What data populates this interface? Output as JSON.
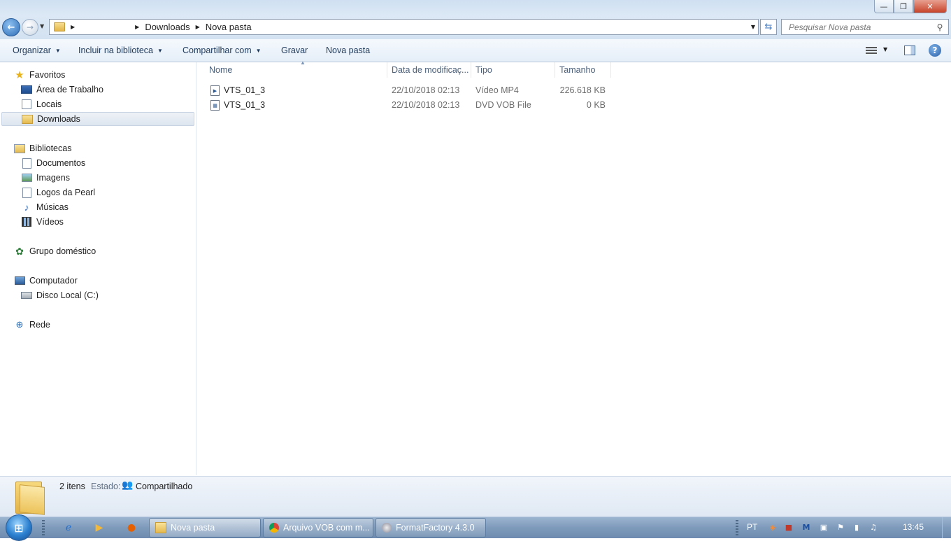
{
  "window": {
    "minimize_glyph": "—",
    "restore_glyph": "❐",
    "close_glyph": "✕"
  },
  "address": {
    "segments": [
      "Downloads",
      "Nova pasta"
    ]
  },
  "search": {
    "placeholder": "Pesquisar Nova pasta"
  },
  "toolbar": {
    "organize": "Organizar",
    "include_library": "Incluir na biblioteca",
    "share_with": "Compartilhar com",
    "burn": "Gravar",
    "new_folder": "Nova pasta"
  },
  "nav": {
    "favorites": "Favoritos",
    "desktop": "Área de Trabalho",
    "places": "Locais",
    "downloads": "Downloads",
    "libraries": "Bibliotecas",
    "documents": "Documentos",
    "images": "Imagens",
    "pearl_logos": "Logos da Pearl",
    "music": "Músicas",
    "videos": "Vídeos",
    "homegroup": "Grupo doméstico",
    "computer": "Computador",
    "local_disk": "Disco Local (C:)",
    "network": "Rede"
  },
  "columns": {
    "name": "Nome",
    "date": "Data de modificaç...",
    "type": "Tipo",
    "size": "Tamanho"
  },
  "files": [
    {
      "name": "VTS_01_3",
      "date": "22/10/2018 02:13",
      "type": "Vídeo MP4",
      "size": "226.618 KB"
    },
    {
      "name": "VTS_01_3",
      "date": "22/10/2018 02:13",
      "type": "DVD VOB File",
      "size": "0 KB"
    }
  ],
  "details": {
    "count": "2 itens",
    "state_label": "Estado:",
    "state_value": "Compartilhado"
  },
  "taskbar": {
    "buttons": [
      "Nova pasta",
      "Arquivo VOB com m...",
      "FormatFactory 4.3.0"
    ],
    "language": "PT",
    "clock": "13:45"
  },
  "colors": {
    "accent": "#2f6db7",
    "toolbar_text": "#1e395b"
  }
}
